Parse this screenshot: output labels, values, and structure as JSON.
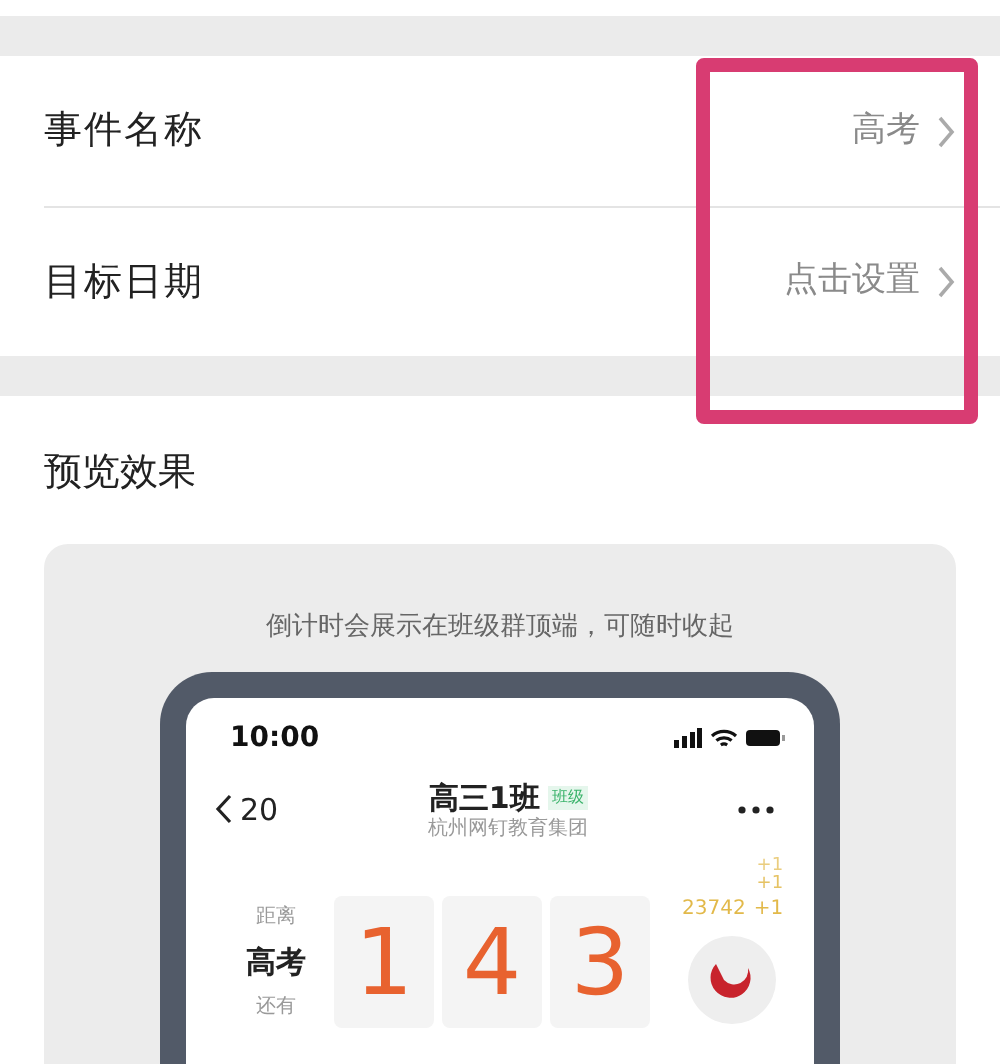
{
  "settings": [
    {
      "label": "事件名称",
      "value": "高考"
    },
    {
      "label": "目标日期",
      "value": "点击设置"
    }
  ],
  "preview": {
    "title": "预览效果",
    "caption": "倒计时会展示在班级群顶端，可随时收起",
    "phone": {
      "time": "10:00",
      "back_count": "20",
      "group_name": "高三1班",
      "group_tag": "班级",
      "org": "杭州网钉教育集团",
      "countdown": {
        "prefix": "距离",
        "event": "高考",
        "suffix": "还有",
        "digits": [
          "1",
          "4",
          "3"
        ]
      },
      "likes": {
        "increments": [
          "+1",
          "+1"
        ],
        "count": "23742",
        "increment": "+1"
      }
    }
  }
}
